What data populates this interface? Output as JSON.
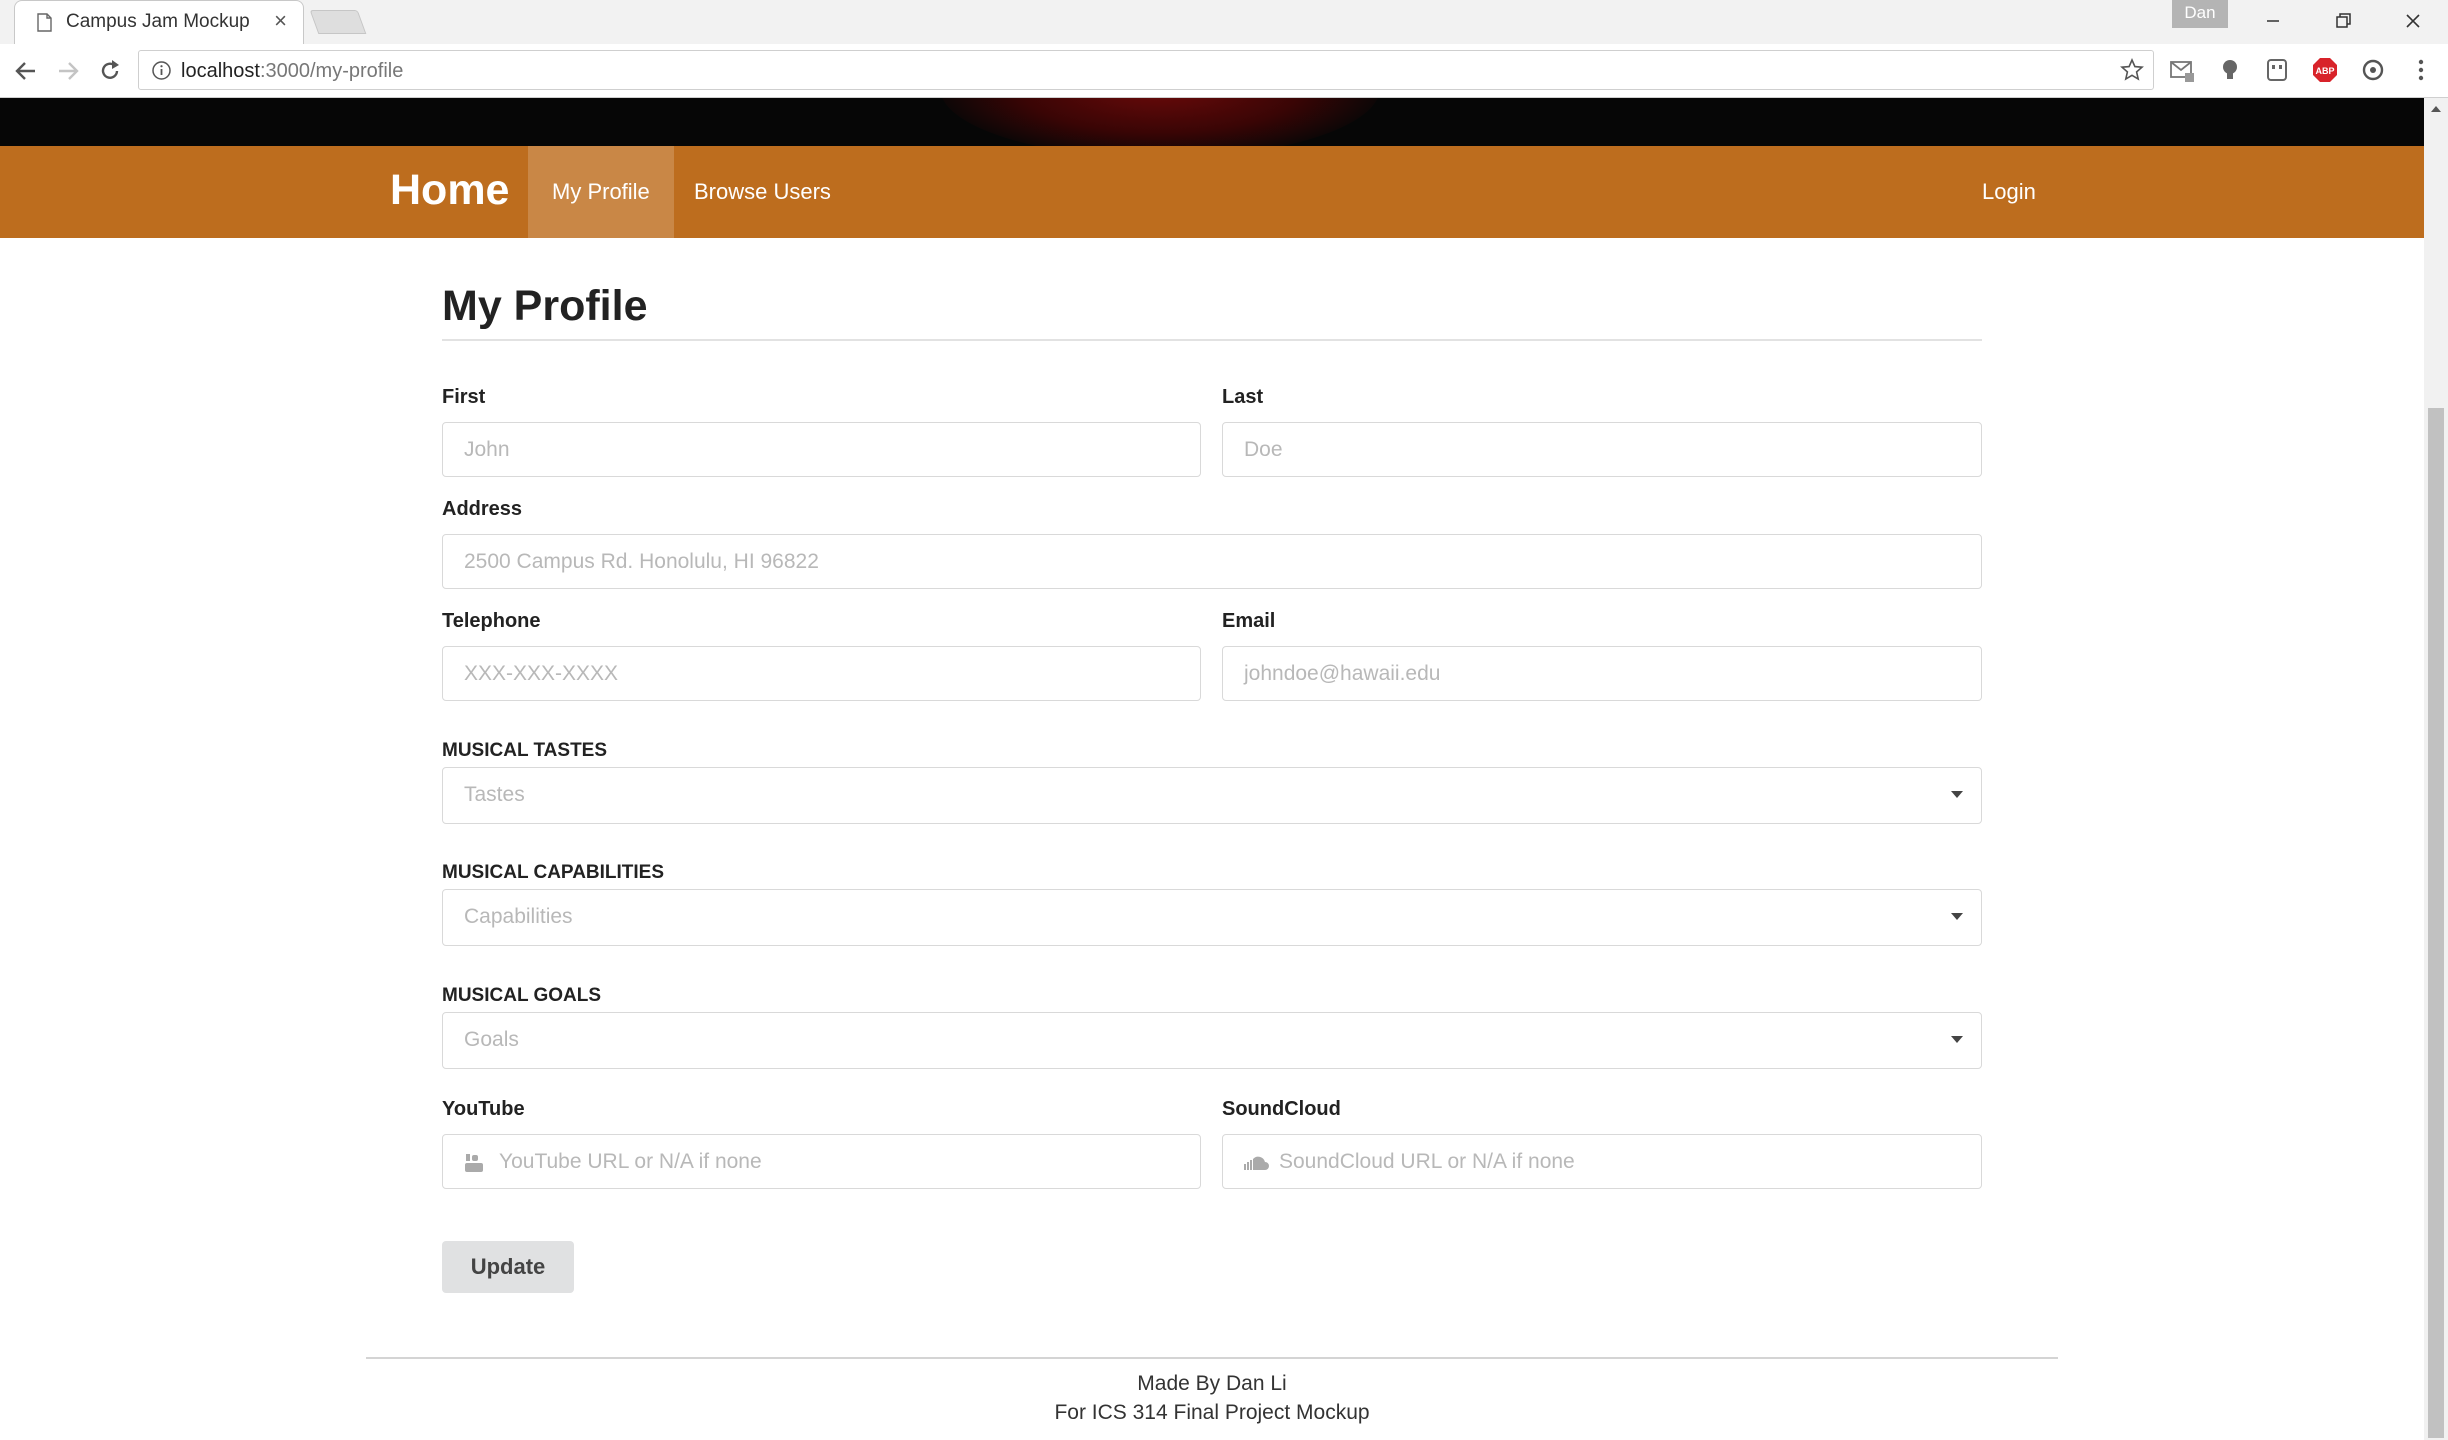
{
  "browser": {
    "tab_title": "Campus Jam Mockup",
    "tab_close": "×",
    "profile_name": "Dan",
    "url_host": "localhost",
    "url_rest": ":3000/my-profile",
    "extensions": [
      "gmail-icon",
      "idea-bulb-icon",
      "ghost-extension-icon",
      "adblock-plus-icon",
      "sync-extension-icon"
    ],
    "adblock_label": "ABP"
  },
  "navbar": {
    "brand": "Home",
    "links": [
      "My Profile",
      "Browse Users"
    ],
    "active": "My Profile",
    "login": "Login",
    "color": "#bd6d1e"
  },
  "page": {
    "title": "My Profile"
  },
  "form": {
    "first": {
      "label": "First",
      "placeholder": "John"
    },
    "last": {
      "label": "Last",
      "placeholder": "Doe"
    },
    "address": {
      "label": "Address",
      "placeholder": "2500 Campus Rd. Honolulu, HI 96822"
    },
    "telephone": {
      "label": "Telephone",
      "placeholder": "XXX-XXX-XXXX"
    },
    "email": {
      "label": "Email",
      "placeholder": "johndoe@hawaii.edu"
    },
    "tastes": {
      "label": "MUSICAL TASTES",
      "placeholder": "Tastes"
    },
    "capabilities": {
      "label": "MUSICAL CAPABILITIES",
      "placeholder": "Capabilities"
    },
    "goals": {
      "label": "MUSICAL GOALS",
      "placeholder": "Goals"
    },
    "youtube": {
      "label": "YouTube",
      "placeholder": "YouTube URL or N/A if none",
      "icon": "youtube-icon"
    },
    "soundcloud": {
      "label": "SoundCloud",
      "placeholder": "SoundCloud URL or N/A if none",
      "icon": "soundcloud-icon"
    },
    "submit": "Update"
  },
  "footer": {
    "line1": "Made By Dan Li",
    "line2": "For ICS 314 Final Project Mockup"
  }
}
